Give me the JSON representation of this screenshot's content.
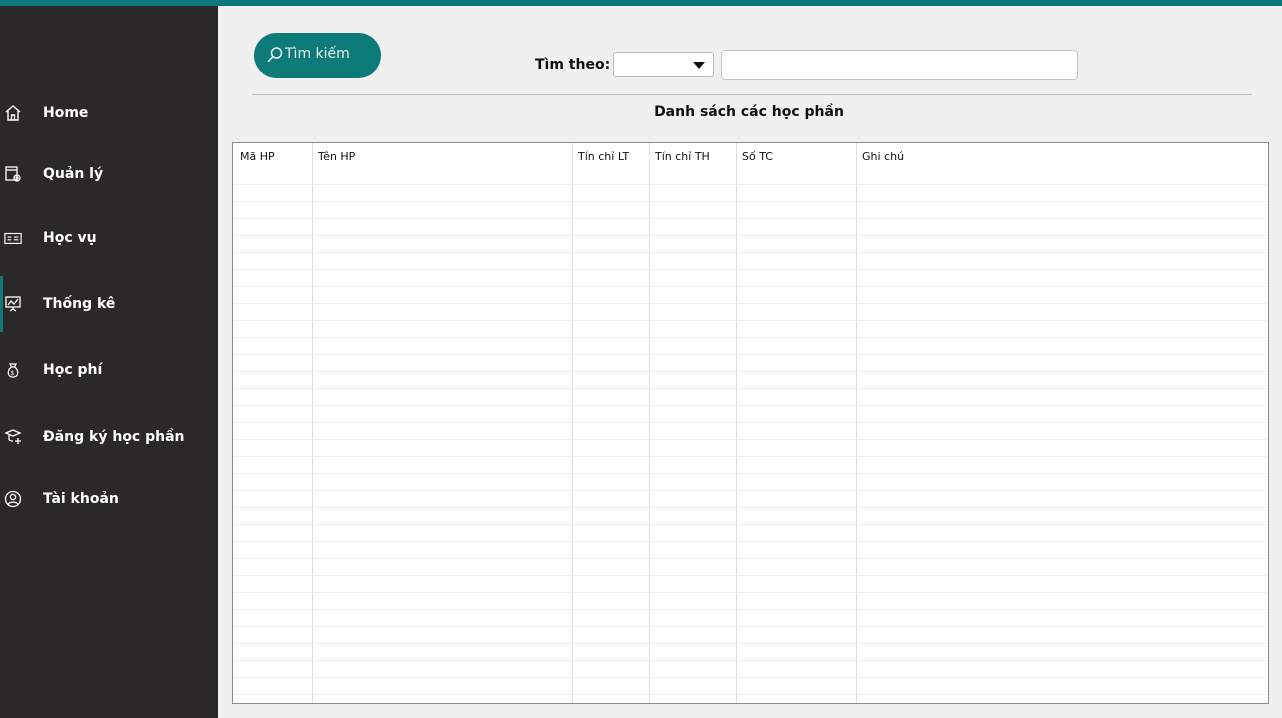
{
  "sidebar": {
    "items": [
      {
        "label": "Home",
        "icon": "home-icon"
      },
      {
        "label": "Quản lý",
        "icon": "manage-settings-icon"
      },
      {
        "label": "Học vụ",
        "icon": "id-card-icon"
      },
      {
        "label": "Thống kê",
        "icon": "presentation-chart-icon"
      },
      {
        "label": "Học phí",
        "icon": "money-bag-icon"
      },
      {
        "label": "Đăng ký học phần",
        "icon": "graduation-register-icon"
      },
      {
        "label": "Tài khoản",
        "icon": "user-circle-icon"
      }
    ],
    "active_index": 3
  },
  "search": {
    "button_label": "Tìm kiếm",
    "filter_label": "Tìm theo:",
    "select_value": "",
    "query_value": ""
  },
  "list": {
    "title": "Danh sách các học phần",
    "columns": [
      "Mã HP",
      "Tên HP",
      "Tín chỉ LT",
      "Tín chỉ TH",
      "Số TC",
      "Ghi chú"
    ],
    "rows": []
  },
  "colors": {
    "accent": "#0b7a78",
    "sidebar_bg": "#2a2829",
    "content_bg": "#f0f0f0"
  }
}
